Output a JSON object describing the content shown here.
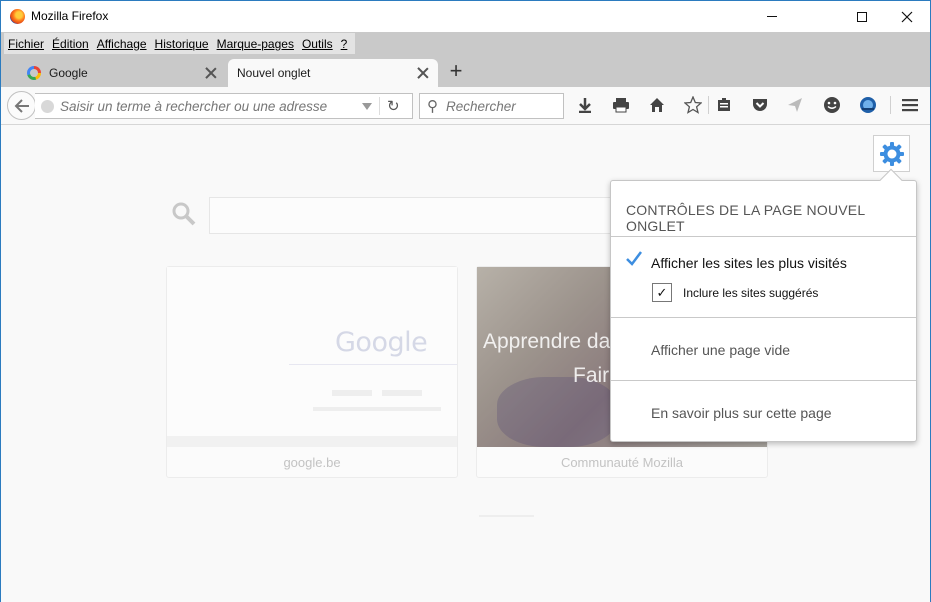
{
  "window": {
    "title": "Mozilla Firefox"
  },
  "menubar": {
    "items": [
      "Fichier",
      "Édition",
      "Affichage",
      "Historique",
      "Marque-pages",
      "Outils",
      "?"
    ]
  },
  "tabs": [
    {
      "label": "Google",
      "icon": "google-favicon-icon"
    },
    {
      "label": "Nouvel onglet",
      "active": true
    }
  ],
  "navbar": {
    "url_placeholder": "Saisir un terme à rechercher ou une adresse",
    "search_placeholder": "Rechercher"
  },
  "tiles": [
    {
      "caption": "google.be",
      "thumb_text": "Google"
    },
    {
      "caption": "Communauté Mozilla",
      "thumb_text_line1": "Apprendre dav",
      "thumb_text_line2": "Faire"
    }
  ],
  "popup": {
    "title": "CONTRÔLES DE LA PAGE NOUVEL ONGLET",
    "option_most_visited": "Afficher les sites les plus visités",
    "option_most_visited_selected": true,
    "checkbox_label": "Inclure les sites suggérés",
    "checkbox_checked": true,
    "option_blank": "Afficher une page vide",
    "learn_more": "En savoir plus sur cette page"
  },
  "colors": {
    "accent": "#3d8ee0",
    "chrome": "#c9c9c9"
  }
}
